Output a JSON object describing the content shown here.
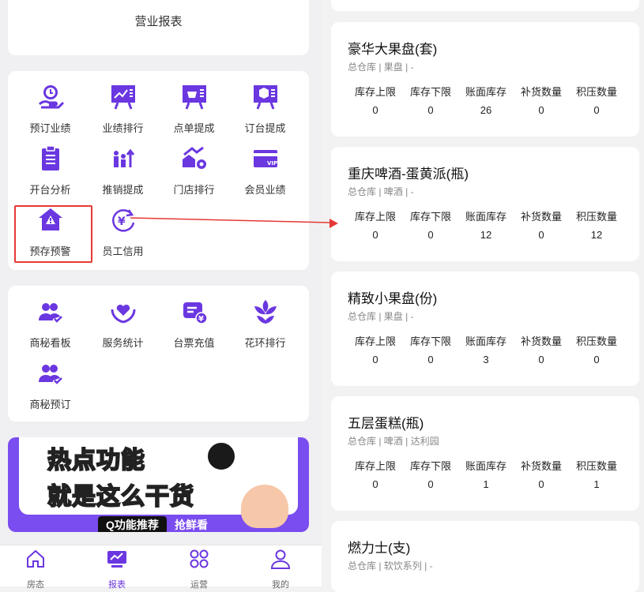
{
  "header": {
    "title": "营业报表"
  },
  "group1": [
    {
      "label": "预订业绩",
      "icon": "clock-hand-icon"
    },
    {
      "label": "业绩排行",
      "icon": "trend-board-icon"
    },
    {
      "label": "点单提成",
      "icon": "basket-board-icon"
    },
    {
      "label": "订台提成",
      "icon": "box-board-icon"
    },
    {
      "label": "开台分析",
      "icon": "clipboard-icon"
    },
    {
      "label": "推销提成",
      "icon": "people-up-icon"
    },
    {
      "label": "门店排行",
      "icon": "store-gear-icon"
    },
    {
      "label": "会员业绩",
      "icon": "vip-card-icon"
    },
    {
      "label": "预存预警",
      "icon": "house-warning-icon"
    },
    {
      "label": "员工信用",
      "icon": "yen-refresh-icon"
    }
  ],
  "group2": [
    {
      "label": "商秘看板",
      "icon": "users-check-icon"
    },
    {
      "label": "服务统计",
      "icon": "heart-hands-icon"
    },
    {
      "label": "台票充值",
      "icon": "ticket-yen-icon"
    },
    {
      "label": "花环排行",
      "icon": "flower-icon"
    },
    {
      "label": "商秘预订",
      "icon": "users-check-icon"
    }
  ],
  "banner": {
    "line1": "热点功能",
    "line2": "就是这么干货",
    "badge": "Q功能推荐",
    "badge2": "抢鲜看"
  },
  "tabs": [
    {
      "label": "房态",
      "icon": "home-icon"
    },
    {
      "label": "报表",
      "icon": "chart-screen-icon",
      "active": true
    },
    {
      "label": "运营",
      "icon": "grid-icon"
    },
    {
      "label": "我的",
      "icon": "user-icon"
    }
  ],
  "stock": {
    "headers": [
      "库存上限",
      "库存下限",
      "账面库存",
      "补货数量",
      "积压数量"
    ],
    "items": [
      {
        "name": "豪华大果盘(套)",
        "sub": "总仓库 | 果盘 | -",
        "values": [
          "0",
          "0",
          "26",
          "0",
          "0"
        ]
      },
      {
        "name": "重庆啤酒-蛋黄派(瓶)",
        "sub": "总仓库 | 啤酒 | -",
        "values": [
          "0",
          "0",
          "12",
          "0",
          "12"
        ]
      },
      {
        "name": "精致小果盘(份)",
        "sub": "总仓库 | 果盘 | -",
        "values": [
          "0",
          "0",
          "3",
          "0",
          "0"
        ]
      },
      {
        "name": "五层蛋糕(瓶)",
        "sub": "总仓库 | 啤酒 | 达利园",
        "values": [
          "0",
          "0",
          "1",
          "0",
          "1"
        ]
      },
      {
        "name": "燃力士(支)",
        "sub": "总仓库 | 软饮系列 | -"
      }
    ]
  },
  "colors": {
    "accent": "#6a37e0",
    "highlight": "#e53935"
  }
}
